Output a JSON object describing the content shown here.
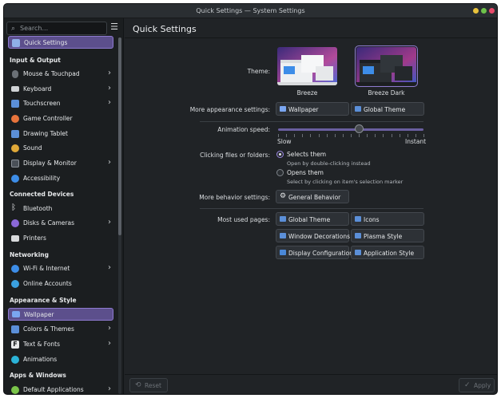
{
  "window": {
    "title": "Quick Settings — System Settings"
  },
  "sidebar": {
    "search_placeholder": "Search...",
    "items": [
      {
        "label": "Quick Settings",
        "icon": "quick-settings-icon",
        "color": "#8fb0e8"
      },
      {
        "label": "Mouse & Touchpad",
        "icon": "mouse-icon",
        "color": "#6a7076"
      },
      {
        "label": "Keyboard",
        "icon": "keyboard-icon",
        "color": "#d0d3d6"
      },
      {
        "label": "Touchscreen",
        "icon": "touchscreen-icon",
        "color": "#5b8fd8"
      },
      {
        "label": "Game Controller",
        "icon": "game-controller-icon",
        "color": "#e8743c"
      },
      {
        "label": "Drawing Tablet",
        "icon": "drawing-tablet-icon",
        "color": "#5b8fd8"
      },
      {
        "label": "Sound",
        "icon": "sound-icon",
        "color": "#e0a838"
      },
      {
        "label": "Display & Monitor",
        "icon": "display-icon",
        "color": "#4a5058"
      },
      {
        "label": "Accessibility",
        "icon": "accessibility-icon",
        "color": "#3d8de8"
      },
      {
        "label": "Bluetooth",
        "icon": "bluetooth-icon",
        "color": "#e6e8ea"
      },
      {
        "label": "Disks & Cameras",
        "icon": "disks-cameras-icon",
        "color": "#8a68d8"
      },
      {
        "label": "Printers",
        "icon": "printer-icon",
        "color": "#d8dadc"
      },
      {
        "label": "Wi-Fi & Internet",
        "icon": "wifi-icon",
        "color": "#3d8de8"
      },
      {
        "label": "Online Accounts",
        "icon": "online-accounts-icon",
        "color": "#3aa0e0"
      },
      {
        "label": "Wallpaper",
        "icon": "wallpaper-icon",
        "color": "#7aa6f0"
      },
      {
        "label": "Colors & Themes",
        "icon": "colors-themes-icon",
        "color": "#5b8fd8"
      },
      {
        "label": "Text & Fonts",
        "icon": "text-fonts-icon",
        "color": "#e6e8ea"
      },
      {
        "label": "Animations",
        "icon": "animations-icon",
        "color": "#2bb3d8"
      },
      {
        "label": "Default Applications",
        "icon": "default-apps-icon",
        "color": "#7ac44a"
      }
    ],
    "sections": {
      "input_output": "Input & Output",
      "connected_devices": "Connected Devices",
      "networking": "Networking",
      "appearance_style": "Appearance & Style",
      "apps_windows": "Apps & Windows"
    }
  },
  "main": {
    "title": "Quick Settings",
    "theme": {
      "label": "Theme:",
      "options": [
        {
          "name": "Breeze",
          "selected": false
        },
        {
          "name": "Breeze Dark",
          "selected": true
        }
      ]
    },
    "appearance": {
      "label": "More appearance settings:",
      "wallpaper_button": "Wallpaper",
      "global_theme_button": "Global Theme"
    },
    "animation": {
      "label": "Animation speed:",
      "slow": "Slow",
      "instant": "Instant",
      "value_fraction": 0.56
    },
    "clicking": {
      "label": "Clicking files or folders:",
      "option1": "Selects them",
      "option1_desc": "Open by double-clicking instead",
      "option2": "Opens them",
      "option2_desc": "Select by clicking on item's selection marker",
      "selected": "option1"
    },
    "behavior": {
      "label": "More behavior settings:",
      "general_behavior_button": "General Behavior"
    },
    "most_used": {
      "label": "Most used pages:",
      "pages": [
        "Global Theme",
        "Icons",
        "Window Decorations",
        "Plasma Style",
        "Display Configuration",
        "Application Style"
      ]
    },
    "footer": {
      "reset": "Reset",
      "apply": "Apply"
    }
  },
  "colors": {
    "accent": "#8e7bd0",
    "selection": "#5c4f8c",
    "window_bg": "#202326",
    "sidebar_bg": "#1b1e20"
  }
}
